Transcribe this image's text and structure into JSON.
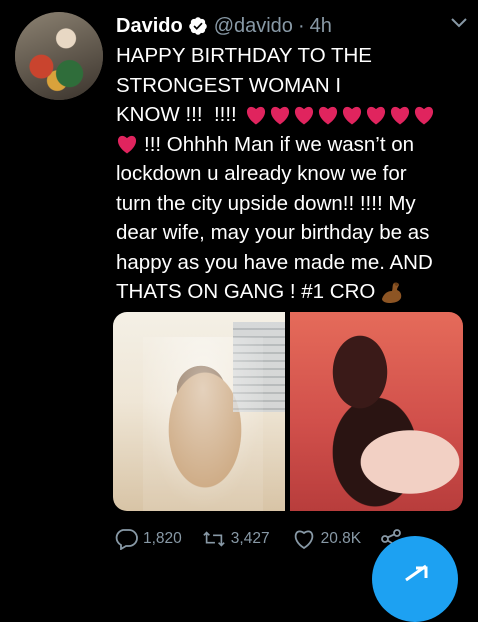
{
  "tweet": {
    "author_name": "Davido",
    "author_handle": "@davido",
    "separator": "·",
    "time": "4h",
    "text_lines": [
      "HAPPY BIRTHDAY TO THE",
      "STRONGEST WOMAN I",
      "KNOW !!!  !!!!",
      "!!! Ohhhh Man if we wasn’t on",
      "lockdown u already know we for",
      "turn the city upside down!! !!!! My",
      "dear wife, may your birthday be as",
      "happy as you have made me. AND",
      "THATS ON GANG ! #1 CRO"
    ],
    "heart_count_line3": 8,
    "heart_color": "#e0245e"
  },
  "actions": {
    "replies": "1,820",
    "retweets": "3,427",
    "likes": "20.8K"
  },
  "colors": {
    "background": "#000000",
    "secondary_text": "#8899a6",
    "verified": "#ffffff",
    "fab": "#1da1f2"
  },
  "icons": [
    "verified-icon",
    "chevron-down-icon",
    "heart-emoji",
    "flexed-biceps-emoji",
    "reply-icon",
    "retweet-icon",
    "like-icon",
    "share-icon",
    "compose-icon"
  ]
}
